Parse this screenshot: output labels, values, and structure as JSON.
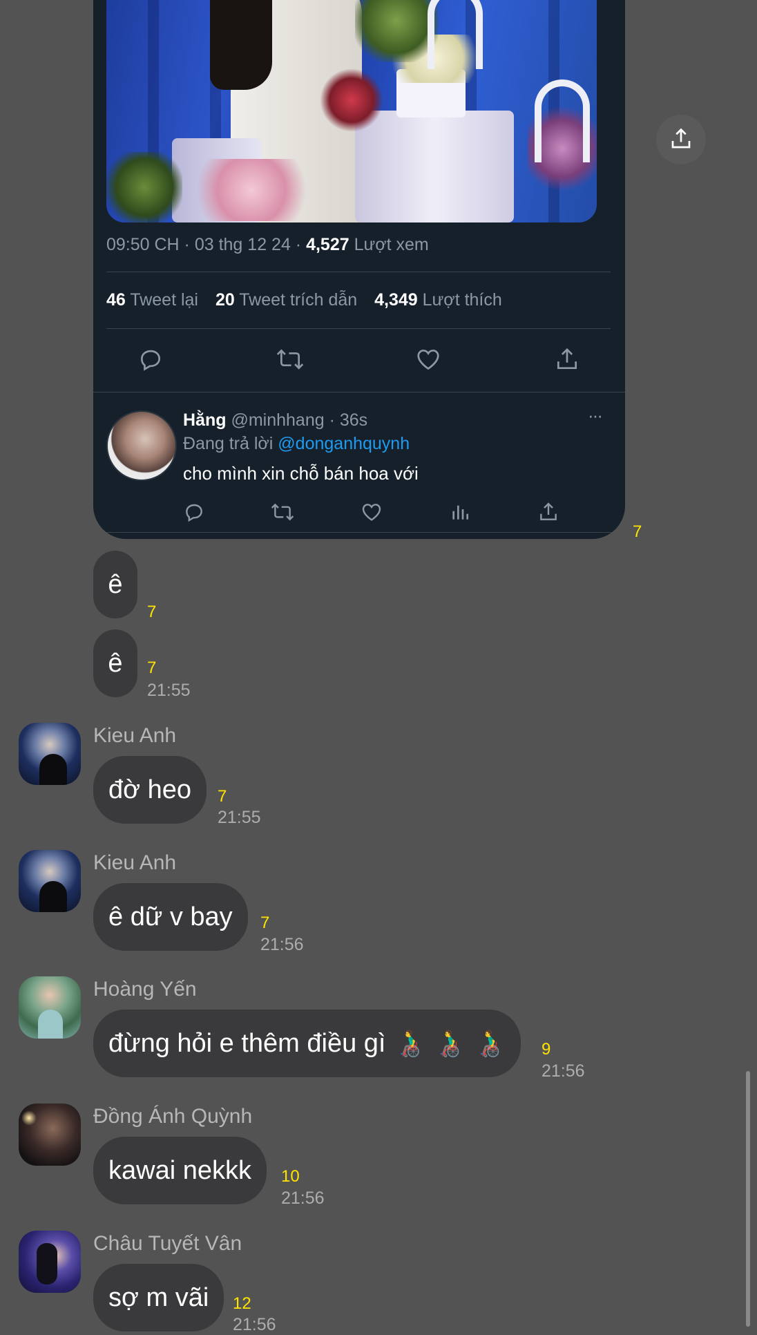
{
  "tweet": {
    "time_date": "09:50 CH · 03 thg 12 24 ·",
    "views_count": "4,527",
    "views_label": "Lượt xem",
    "retweets_count": "46",
    "retweets_label": "Tweet lại",
    "quotes_count": "20",
    "quotes_label": "Tweet trích dẫn",
    "likes_count": "4,349",
    "likes_label": "Lượt thích",
    "reply": {
      "name": "Hằng",
      "handle_time": "@minhhang · 36s",
      "replying_prefix": "Đang trả lời",
      "mention": "@donganhquynh",
      "text": "cho mình xin chỗ bán hoa với",
      "more": "···"
    },
    "card_count": "7"
  },
  "messages": [
    {
      "text": "ê",
      "count": "7"
    },
    {
      "text": "ê",
      "count": "7",
      "time": "21:55"
    },
    {
      "sender": "Kieu Anh",
      "text": "đờ heo",
      "count": "7",
      "time": "21:55"
    },
    {
      "sender": "Kieu Anh",
      "text": "ê dữ v bay",
      "count": "7",
      "time": "21:56"
    },
    {
      "sender": "Hoàng Yến",
      "text": "đừng hỏi e thêm điều gì 👨‍🦽 👨‍🦽 👨‍🦽",
      "count": "9",
      "time": "21:56"
    },
    {
      "sender": "Đồng Ánh Quỳnh",
      "text": "kawai nekkk",
      "count": "10",
      "time": "21:56"
    },
    {
      "sender": "Châu Tuyết Vân",
      "text": "sợ m vãi",
      "count": "12",
      "time": "21:56"
    }
  ],
  "icons": {
    "reply": "speech-bubble-icon",
    "retweet": "retweet-icon",
    "like": "heart-icon",
    "share": "share-icon",
    "analytics": "bar-chart-icon"
  },
  "colors": {
    "background": "#545354",
    "card": "#15202b",
    "bubble": "#3a3a3c",
    "count": "#ffe400",
    "mention": "#1d9bf0"
  }
}
